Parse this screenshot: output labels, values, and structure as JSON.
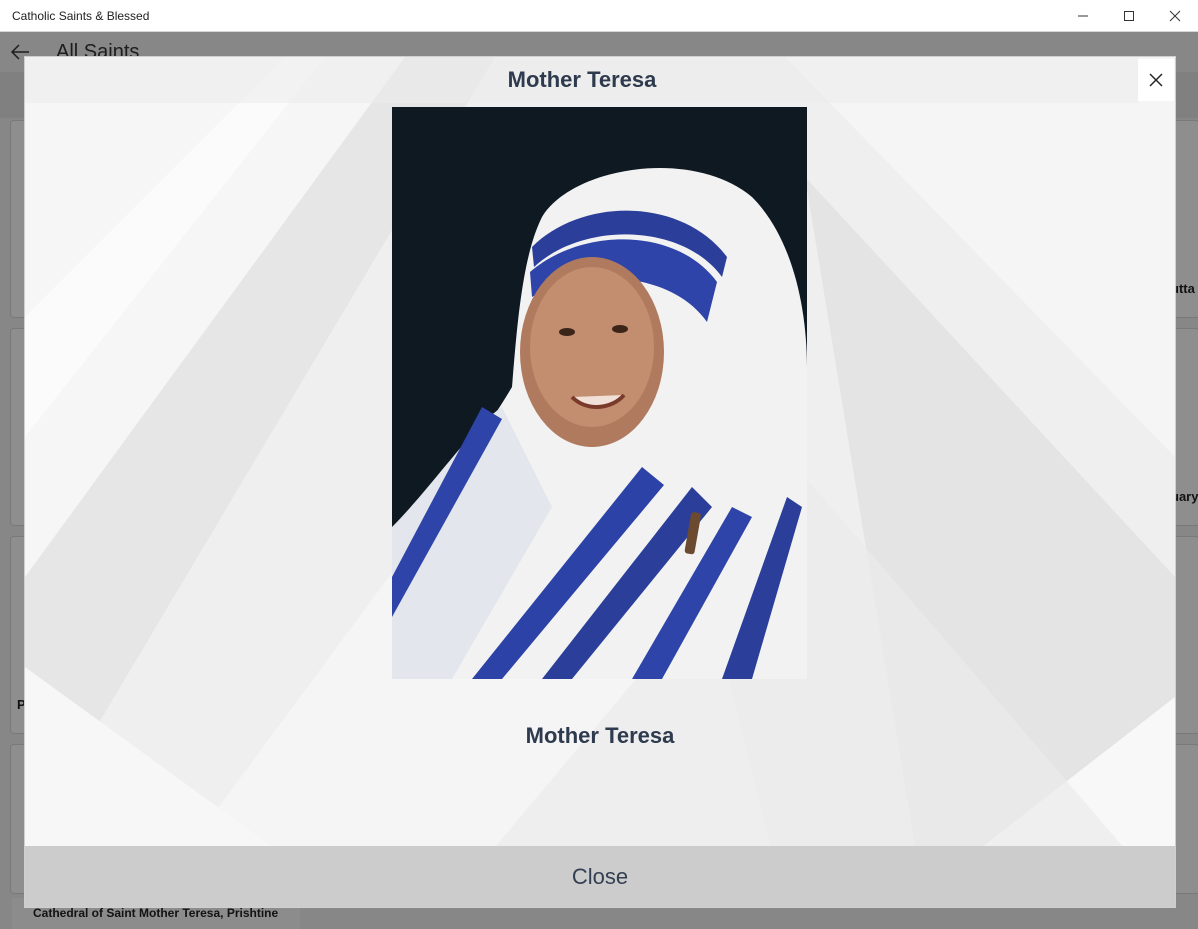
{
  "window": {
    "title": "Catholic Saints & Blessed",
    "minimize_icon": "minimize-icon",
    "maximize_icon": "maximize-icon",
    "close_icon": "close-icon"
  },
  "background_app": {
    "page_title": "All Saints",
    "card_texts": [
      "utta",
      "uary",
      "P"
    ],
    "caption": "Cathedral of Saint Mother Teresa, Prishtine"
  },
  "dialog": {
    "title": "Mother Teresa",
    "caption": "Mother Teresa",
    "close_button_label": "Close",
    "close_icon": "close-icon",
    "colors": {
      "text": "#2e3a4d",
      "footer": "#cccccc",
      "background": "#f0f0f0"
    }
  }
}
